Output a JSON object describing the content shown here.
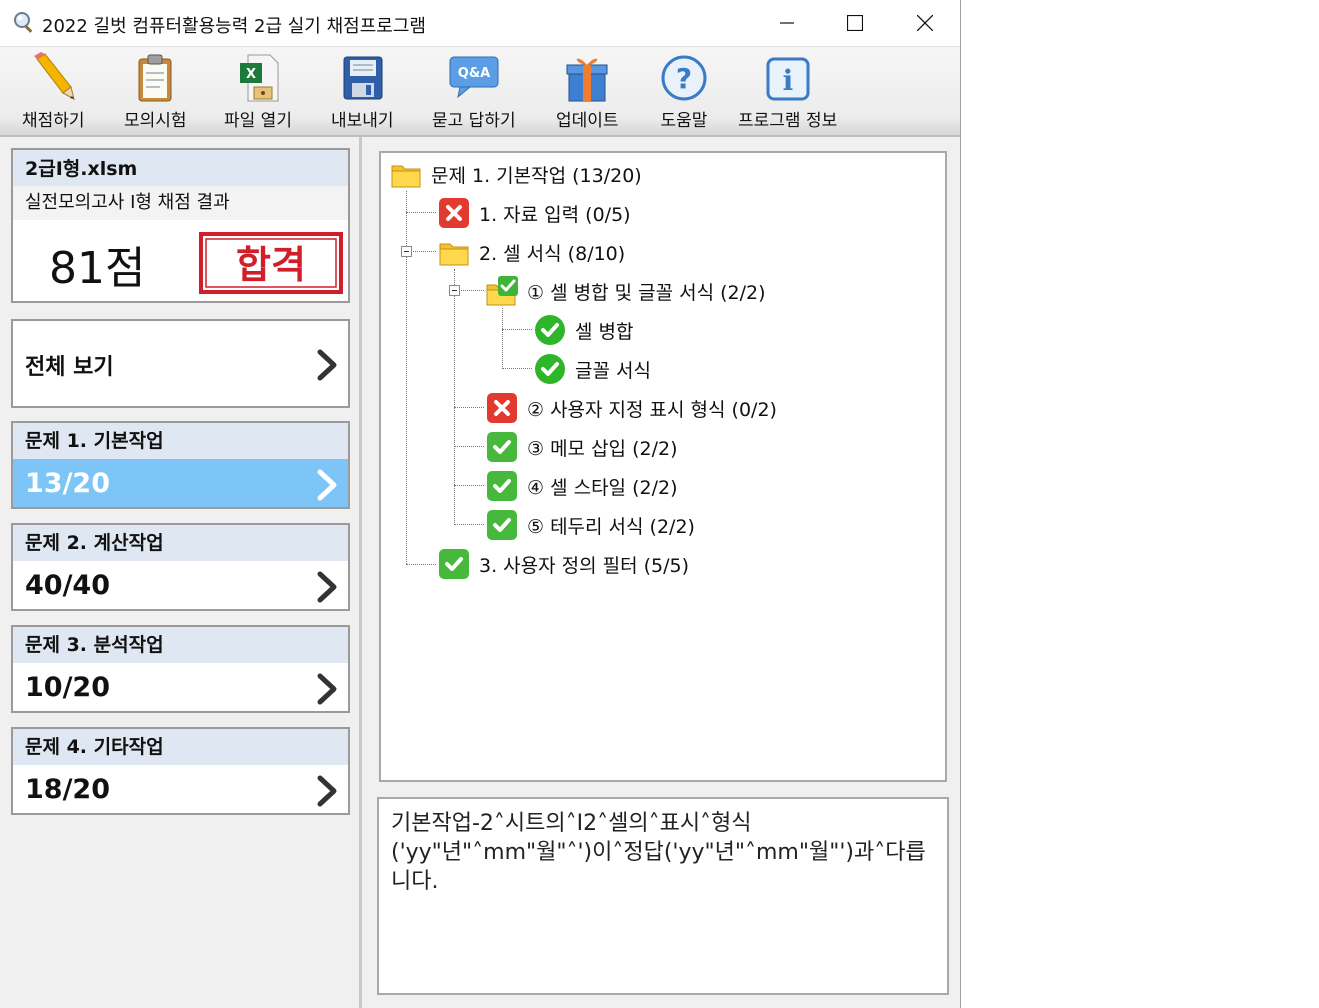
{
  "window": {
    "title": "2022 길벗 컴퓨터활용능력 2급 실기 채점프로그램"
  },
  "toolbar": [
    {
      "label": "채점하기",
      "icon": "pencil-icon"
    },
    {
      "label": "모의시험",
      "icon": "clipboard-icon"
    },
    {
      "label": "파일 열기",
      "icon": "excel-file-icon"
    },
    {
      "label": "내보내기",
      "icon": "floppy-disk-icon"
    },
    {
      "label": "묻고 답하기",
      "icon": "qa-icon"
    },
    {
      "label": "업데이트",
      "icon": "gift-icon"
    },
    {
      "label": "도움말",
      "icon": "help-icon"
    },
    {
      "label": "프로그램 정보",
      "icon": "info-icon"
    }
  ],
  "summary": {
    "filename": "2급I형.xlsm",
    "exam_name": "실전모의고사 I형 채점 결과",
    "score": "81점",
    "result": "합격"
  },
  "view_all": "전체 보기",
  "sections": [
    {
      "title": "문제 1. 기본작업",
      "score": "13/20",
      "selected": true
    },
    {
      "title": "문제 2. 계산작업",
      "score": "40/40",
      "selected": false
    },
    {
      "title": "문제 3. 분석작업",
      "score": "10/20",
      "selected": false
    },
    {
      "title": "문제 4. 기타작업",
      "score": "18/20",
      "selected": false
    }
  ],
  "tree": [
    {
      "label": "문제 1. 기본작업 (13/20)",
      "icon": "folder",
      "level": 0
    },
    {
      "label": "1. 자료 입력 (0/5)",
      "icon": "fail",
      "level": 1
    },
    {
      "label": "2. 셀 서식 (8/10)",
      "icon": "folder",
      "level": 1
    },
    {
      "label": "① 셀 병합 및 글꼴 서식 (2/2)",
      "icon": "folder-check",
      "level": 2
    },
    {
      "label": "셀 병합",
      "icon": "circle-check",
      "level": 3
    },
    {
      "label": "글꼴 서식",
      "icon": "circle-check",
      "level": 3
    },
    {
      "label": "② 사용자 지정 표시 형식 (0/2)",
      "icon": "fail",
      "level": 2
    },
    {
      "label": "③ 메모 삽입 (2/2)",
      "icon": "pass",
      "level": 2
    },
    {
      "label": "④ 셀 스타일 (2/2)",
      "icon": "pass",
      "level": 2
    },
    {
      "label": "⑤ 테두리 서식 (2/2)",
      "icon": "pass",
      "level": 2
    },
    {
      "label": "3. 사용자 정의 필터 (5/5)",
      "icon": "pass",
      "level": 1
    }
  ],
  "message": "기본작업-2˄시트의˄I2˄셀의˄표시˄형식('yy\"년\"˄mm\"월\"˄')이˄정답('yy\"년\"˄mm\"월\"')과˄다릅니다."
}
